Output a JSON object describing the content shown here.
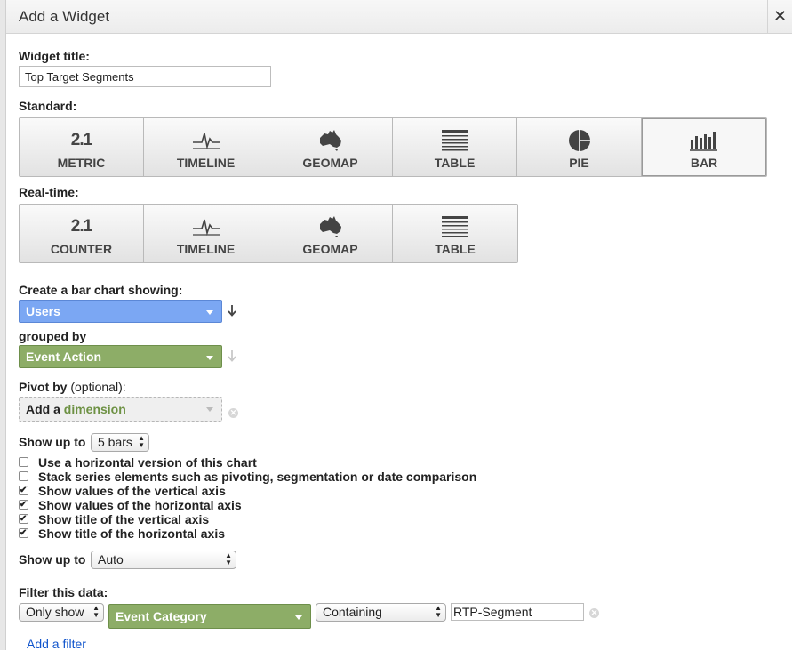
{
  "dialog": {
    "title": "Add a Widget",
    "close_glyph": "✕"
  },
  "widget_title": {
    "label": "Widget title:",
    "value": "Top Target Segments"
  },
  "standard": {
    "label": "Standard:",
    "tiles": [
      {
        "label": "METRIC",
        "icon": "metric-2.1-icon",
        "icon_text": "2.1"
      },
      {
        "label": "TIMELINE",
        "icon": "timeline-icon"
      },
      {
        "label": "GEOMAP",
        "icon": "australia-map-icon"
      },
      {
        "label": "TABLE",
        "icon": "table-icon"
      },
      {
        "label": "PIE",
        "icon": "pie-icon"
      },
      {
        "label": "BAR",
        "icon": "bar-chart-icon",
        "selected": true
      }
    ]
  },
  "realtime": {
    "label": "Real-time:",
    "tiles": [
      {
        "label": "COUNTER",
        "icon": "counter-2.1-icon",
        "icon_text": "2.1"
      },
      {
        "label": "TIMELINE",
        "icon": "timeline-icon"
      },
      {
        "label": "GEOMAP",
        "icon": "australia-map-icon"
      },
      {
        "label": "TABLE",
        "icon": "table-icon"
      }
    ]
  },
  "chart_config": {
    "showing_label": "Create a bar chart showing:",
    "metric": "Users",
    "grouped_label": "grouped by",
    "dimension": "Event Action",
    "pivot_label": "Pivot by",
    "pivot_optional": "(optional):",
    "pivot_placeholder_prefix": "Add a",
    "pivot_placeholder_dim": "dimension",
    "show_up_to_label": "Show up to",
    "bars_value": "5 bars",
    "checkboxes": [
      {
        "label": "Use a horizontal version of this chart",
        "checked": false
      },
      {
        "label": "Stack series elements such as pivoting, segmentation or date comparison",
        "checked": false
      },
      {
        "label": "Show values of the vertical axis",
        "checked": true
      },
      {
        "label": "Show values of the horizontal axis",
        "checked": true
      },
      {
        "label": "Show title of the vertical axis",
        "checked": true
      },
      {
        "label": "Show title of the horizontal axis",
        "checked": true
      }
    ],
    "show_up_to_label_2": "Show up to",
    "auto_value": "Auto"
  },
  "filter": {
    "label": "Filter this data:",
    "mode": "Only show",
    "dimension": "Event Category",
    "operator": "Containing",
    "value": "RTP-Segment",
    "add_filter": "Add a filter"
  },
  "colors": {
    "metric_blue": "#7ba7f3",
    "dimension_green": "#8dad67",
    "link": "#1155cc"
  }
}
